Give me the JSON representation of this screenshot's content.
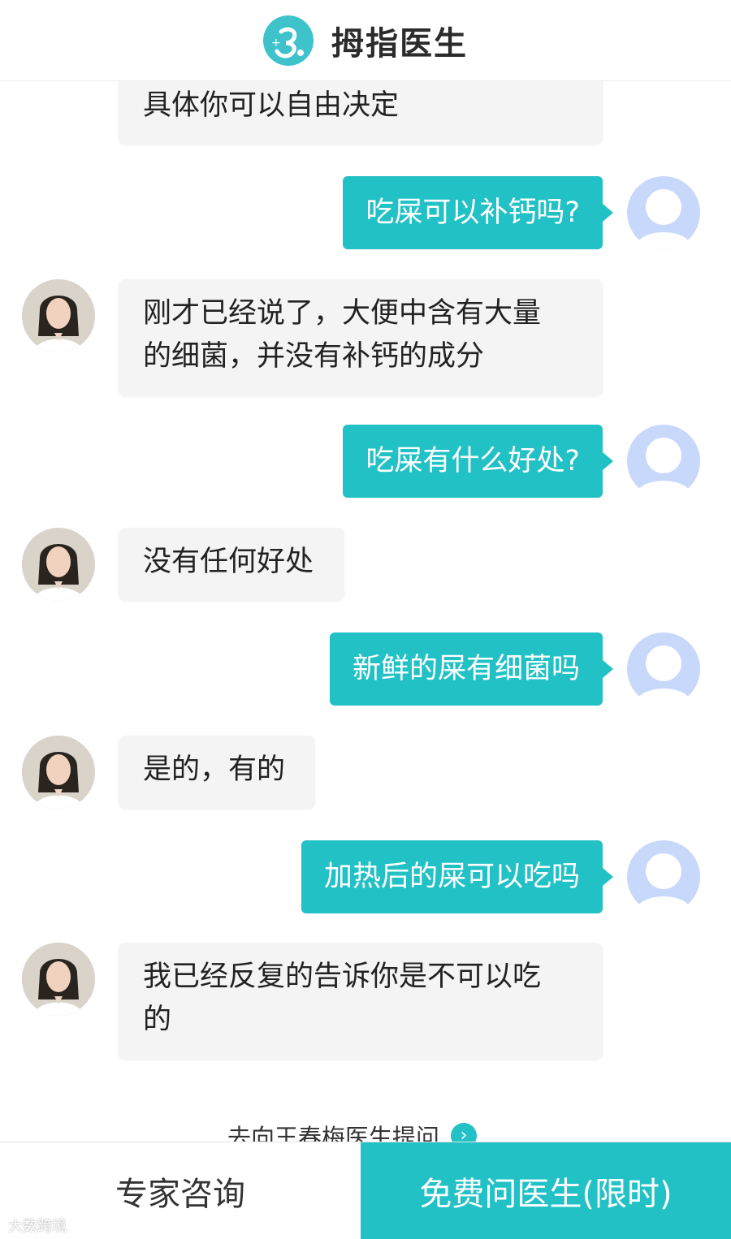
{
  "header": {
    "logo_icon": "thumb-doctor-logo-icon",
    "title": "拇指医生"
  },
  "colors": {
    "accent": "#21c1c6",
    "doctor_bubble": "#f4f4f4",
    "user_avatar": "#c7d8fb"
  },
  "messages": [
    {
      "from": "doctor",
      "text": "具体你可以自由决定"
    },
    {
      "from": "user",
      "text": "吃屎可以补钙吗?"
    },
    {
      "from": "doctor",
      "lines": [
        "刚才已经说了，大便中含有大量",
        "的细菌，并没有补钙的成分"
      ]
    },
    {
      "from": "user",
      "text": "吃屎有什么好处?"
    },
    {
      "from": "doctor",
      "text": "没有任何好处"
    },
    {
      "from": "user",
      "text": "新鲜的屎有细菌吗"
    },
    {
      "from": "doctor",
      "text": "是的，有的"
    },
    {
      "from": "user",
      "text": "加热后的屎可以吃吗"
    },
    {
      "from": "doctor",
      "lines": [
        "我已经反复的告诉你是不可以吃",
        "的"
      ]
    }
  ],
  "ask_link": {
    "label": "去向王春梅医生提问",
    "icon": "chevron-right-icon"
  },
  "footer": {
    "expert_label": "专家咨询",
    "free_label": "免费问医生(限时)"
  },
  "watermark": "大数跨境"
}
